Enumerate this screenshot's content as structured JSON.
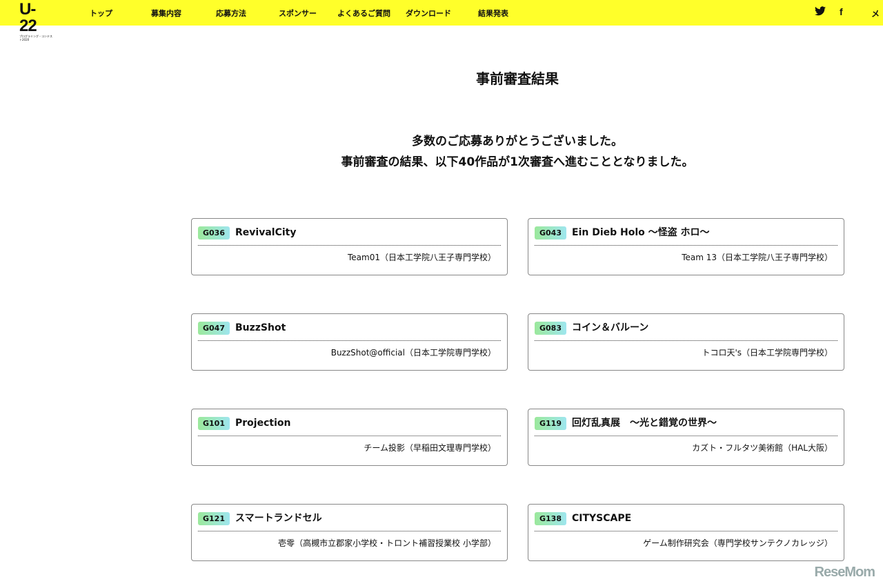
{
  "header": {
    "logo_text": "U-22",
    "logo_sub": "プログラミング・コンテスト2020",
    "nav": [
      "トップ",
      "募集内容",
      "応募方法",
      "スポンサー",
      "よくあるご質問",
      "ダウンロード",
      "結果発表"
    ],
    "social": {
      "twitter": "twitter-icon",
      "facebook": "facebook-icon",
      "cut_label": "メ"
    }
  },
  "page_title": "事前審査結果",
  "intro": [
    "多数のご応募ありがとうございました。",
    "事前審査の結果、以下40作品が1次審査へ進むこととなりました。"
  ],
  "entries": [
    {
      "id": "G036",
      "title": "RevivalCity",
      "team": "Team01（日本工学院八王子専門学校）"
    },
    {
      "id": "G043",
      "title": "Ein Dieb Holo ～怪盗 ホロ～",
      "team": "Team 13（日本工学院八王子専門学校）"
    },
    {
      "id": "G047",
      "title": "BuzzShot",
      "team": "BuzzShot@official（日本工学院専門学校）"
    },
    {
      "id": "G083",
      "title": "コイン＆バルーン",
      "team": "トコロ天's（日本工学院専門学校）"
    },
    {
      "id": "G101",
      "title": "Projection",
      "team": "チーム投影（早稲田文理専門学校）"
    },
    {
      "id": "G119",
      "title": "回灯乱真展　～光と錯覚の世界～",
      "team": "カズト・フルタツ美術館（HAL大阪）"
    },
    {
      "id": "G121",
      "title": "スマートランドセル",
      "team": "壱零（高槻市立郡家小学校・トロント補習授業校 小学部）"
    },
    {
      "id": "G138",
      "title": "CITYSCAPE",
      "team": "ゲーム制作研究会（専門学校サンテクノカレッジ）"
    }
  ],
  "watermark": "ReseMom",
  "colors": {
    "header_bg": "#ffff2a",
    "badge_from": "#9be89b",
    "badge_to": "#9ee6ee"
  }
}
